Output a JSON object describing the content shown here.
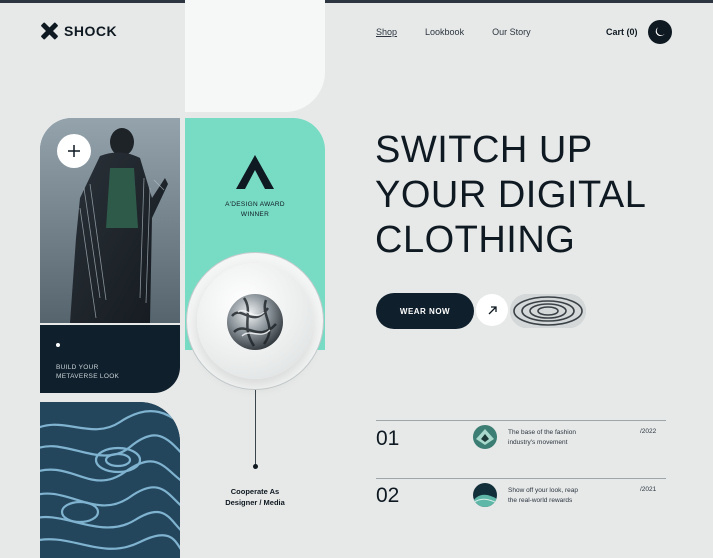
{
  "brand": {
    "name": "SHOCK",
    "icon": "x-logo-icon"
  },
  "nav": {
    "items": [
      {
        "label": "Shop",
        "active": true
      },
      {
        "label": "Lookbook",
        "active": false
      },
      {
        "label": "Our Story",
        "active": false
      }
    ],
    "cart_label": "Cart (0)",
    "theme_icon": "moon-icon"
  },
  "photo_card": {
    "icon": "plus-icon"
  },
  "metaverse_card": {
    "line1": "BUILD YOUR",
    "line2": "METAVERSE LOOK"
  },
  "award": {
    "line1": "A'DESIGN AWARD",
    "line2": "WINNER"
  },
  "cooperate": {
    "line1": "Cooperate As",
    "line2": "Designer / Media"
  },
  "hero": {
    "line1": "SWITCH UP",
    "line2": "YOUR DIGITAL",
    "line3": "CLOTHING",
    "cta_label": "WEAR NOW",
    "arrow_icon": "arrow-up-right-icon"
  },
  "news": [
    {
      "num": "01",
      "line1": "The base of the fashion",
      "line2": "industry's movement",
      "date": "/2022"
    },
    {
      "num": "02",
      "line1": "Show off your look, reap",
      "line2": "the real-world rewards",
      "date": "/2021"
    }
  ],
  "colors": {
    "accent": "#78dbc4",
    "dark": "#0f1f2c",
    "background": "#e7e9e8"
  }
}
